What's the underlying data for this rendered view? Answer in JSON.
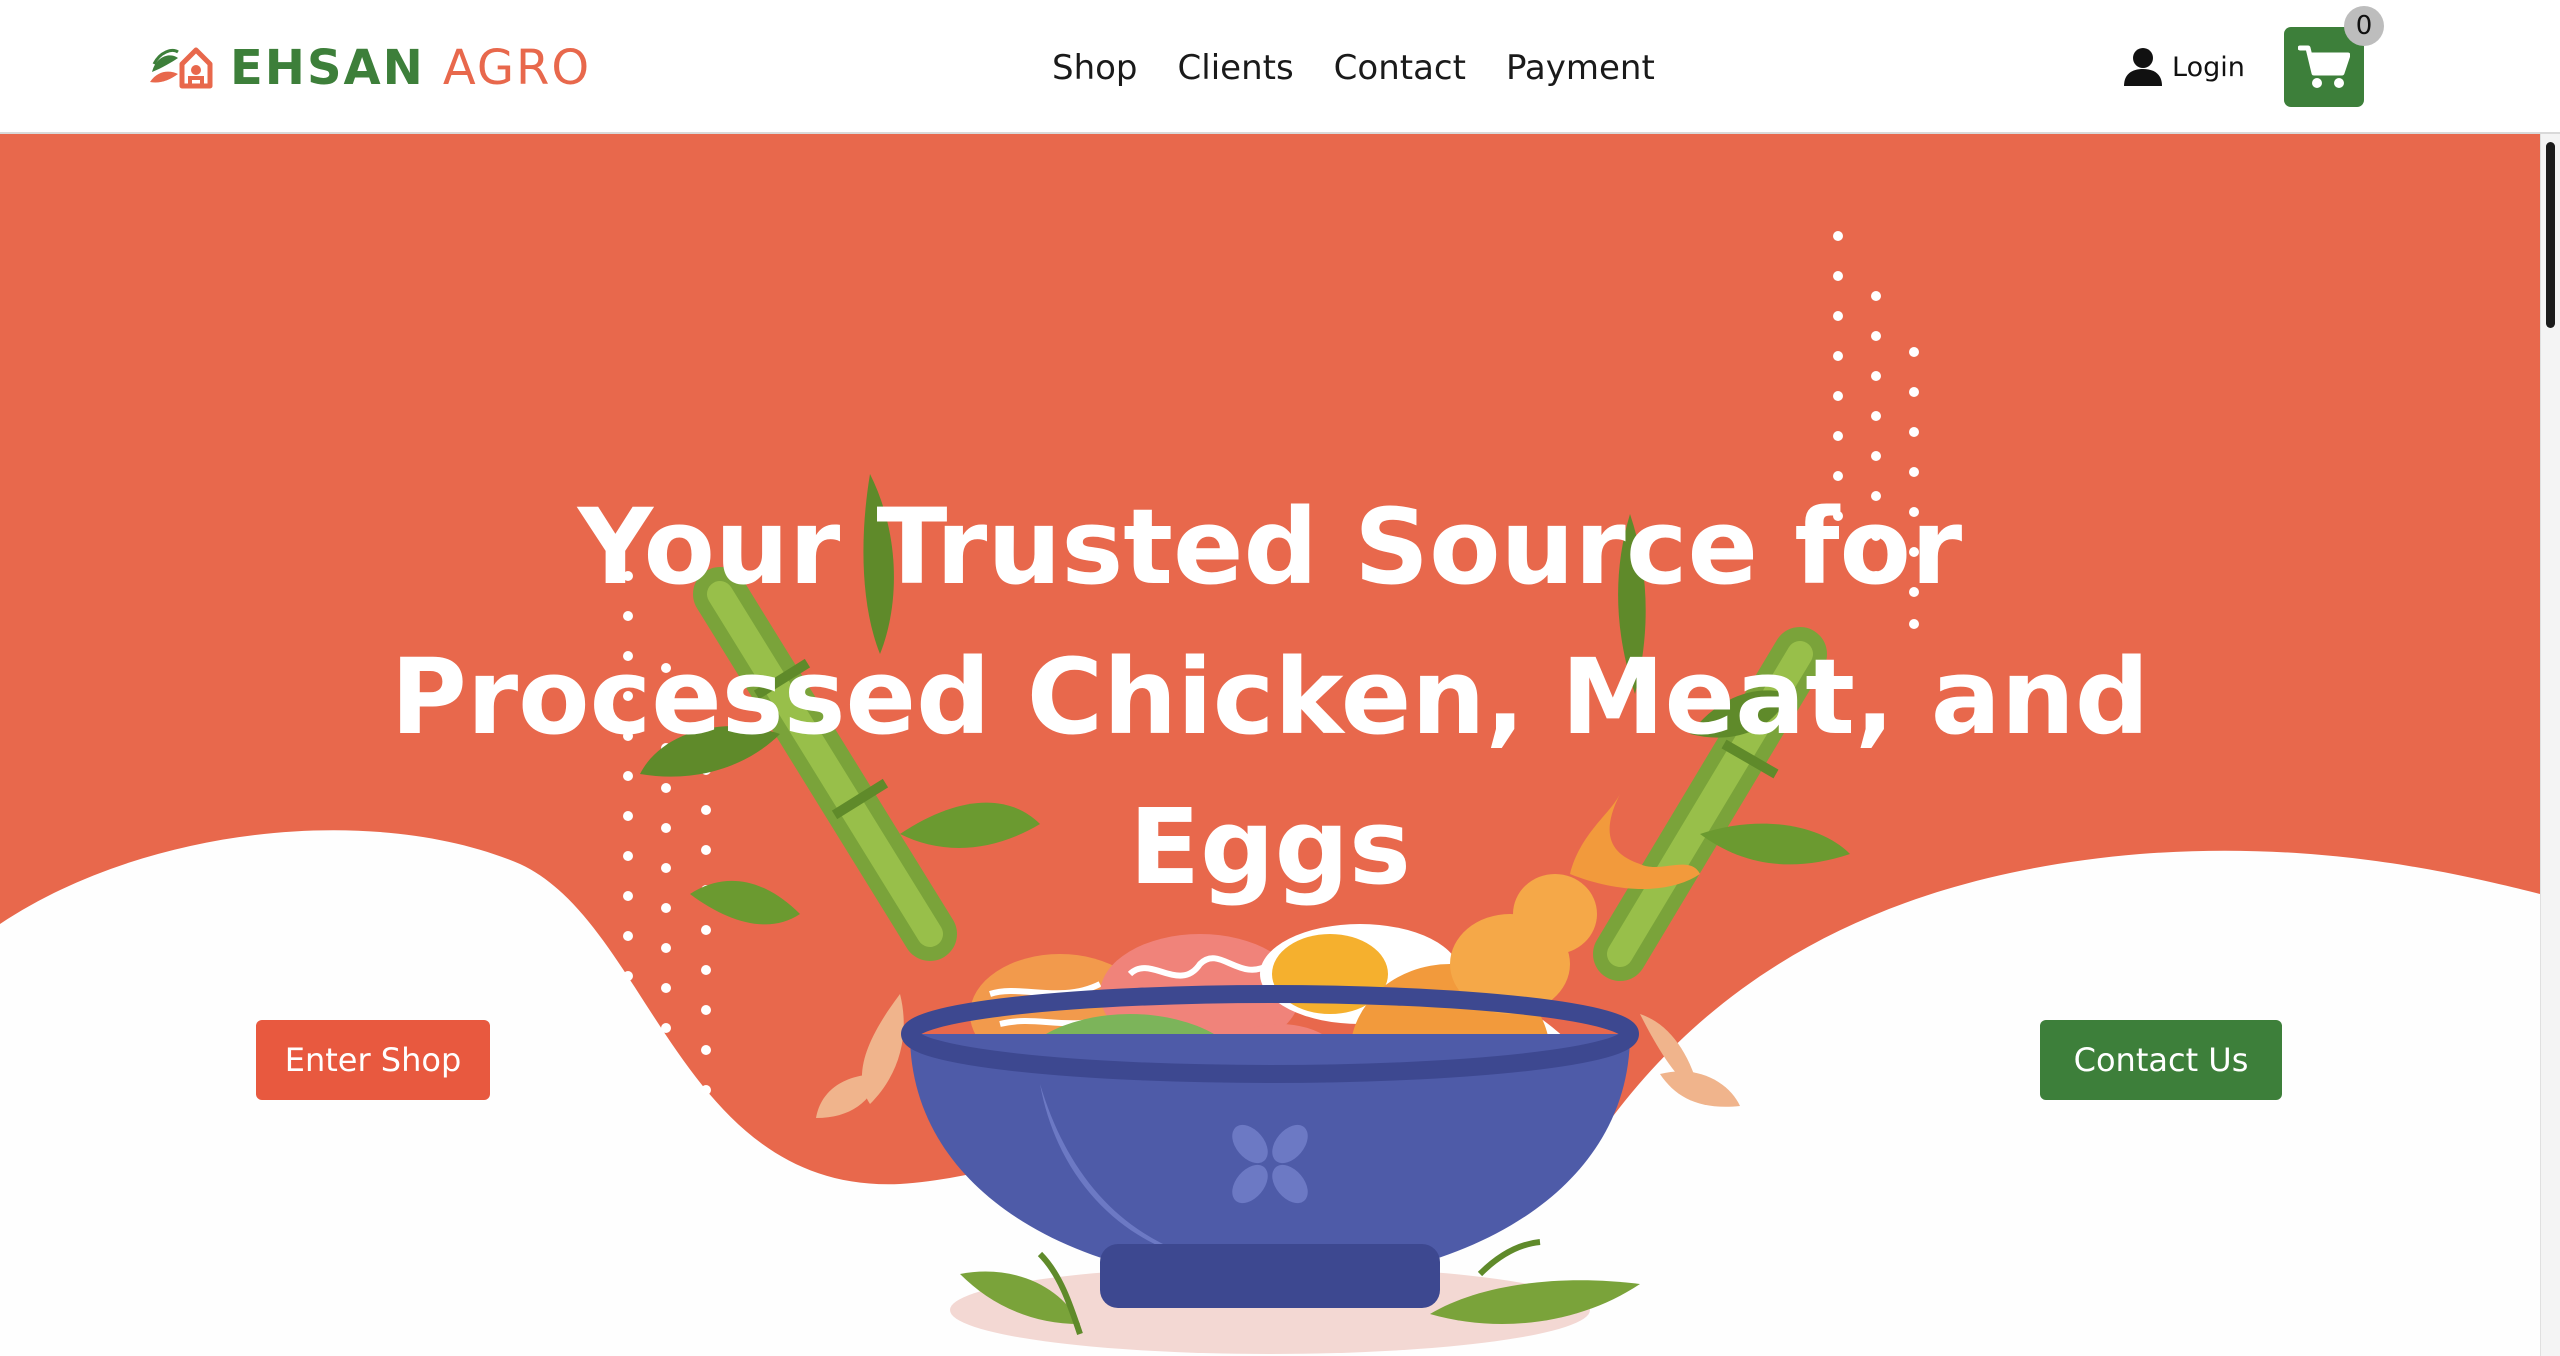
{
  "brand": {
    "name_part1": "EHSAN",
    "name_part2": "AGRO",
    "green": "#3d7f3a",
    "orange": "#e8684c"
  },
  "nav": {
    "items": [
      {
        "label": "Shop"
      },
      {
        "label": "Clients"
      },
      {
        "label": "Contact"
      },
      {
        "label": "Payment"
      }
    ]
  },
  "header": {
    "login_label": "Login",
    "login_icon": "user-icon",
    "cart_icon": "shopping-cart-icon",
    "cart_count": "0"
  },
  "hero": {
    "title": "Your Trusted Source for Processed Chicken, Meat, and Eggs",
    "background_color": "#e8684c",
    "illustration": "food-bowl-illustration",
    "buttons": {
      "enter_shop": "Enter Shop",
      "contact_us": "Contact Us"
    }
  }
}
